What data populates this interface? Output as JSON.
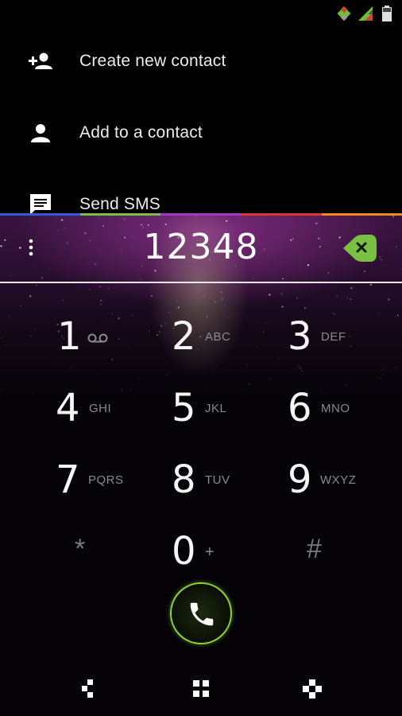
{
  "status_bar": {
    "icons": [
      "notification-diamond-icon",
      "signal-icon",
      "battery-icon"
    ]
  },
  "menu": {
    "items": [
      {
        "label": "Create new contact",
        "icon": "person-add-icon"
      },
      {
        "label": "Add to a contact",
        "icon": "person-icon"
      },
      {
        "label": "Send SMS",
        "icon": "message-icon"
      }
    ]
  },
  "color_bar": [
    "#2e5bd6",
    "#7ac142",
    "#a238c9",
    "#d63a2e",
    "#f08a1c"
  ],
  "dialer": {
    "digits": "12348",
    "overflow_icon": "more-vert-icon",
    "backspace_icon": "backspace-icon"
  },
  "keypad": {
    "keys": [
      {
        "num": "1",
        "letters": "",
        "extra_icon": "voicemail-icon"
      },
      {
        "num": "2",
        "letters": "ABC"
      },
      {
        "num": "3",
        "letters": "DEF"
      },
      {
        "num": "4",
        "letters": "GHI"
      },
      {
        "num": "5",
        "letters": "JKL"
      },
      {
        "num": "6",
        "letters": "MNO"
      },
      {
        "num": "7",
        "letters": "PQRS"
      },
      {
        "num": "8",
        "letters": "TUV"
      },
      {
        "num": "9",
        "letters": "WXYZ"
      },
      {
        "num": "*",
        "letters": ""
      },
      {
        "num": "0",
        "letters": "+"
      },
      {
        "num": "#",
        "letters": ""
      }
    ]
  },
  "call_button": {
    "icon": "phone-icon"
  },
  "nav_bar": {
    "icons": [
      "back-icon",
      "home-icon",
      "recents-icon"
    ]
  },
  "colors": {
    "accent": "#8cd33a",
    "background": "#000000",
    "galaxy": "#3a1340"
  }
}
